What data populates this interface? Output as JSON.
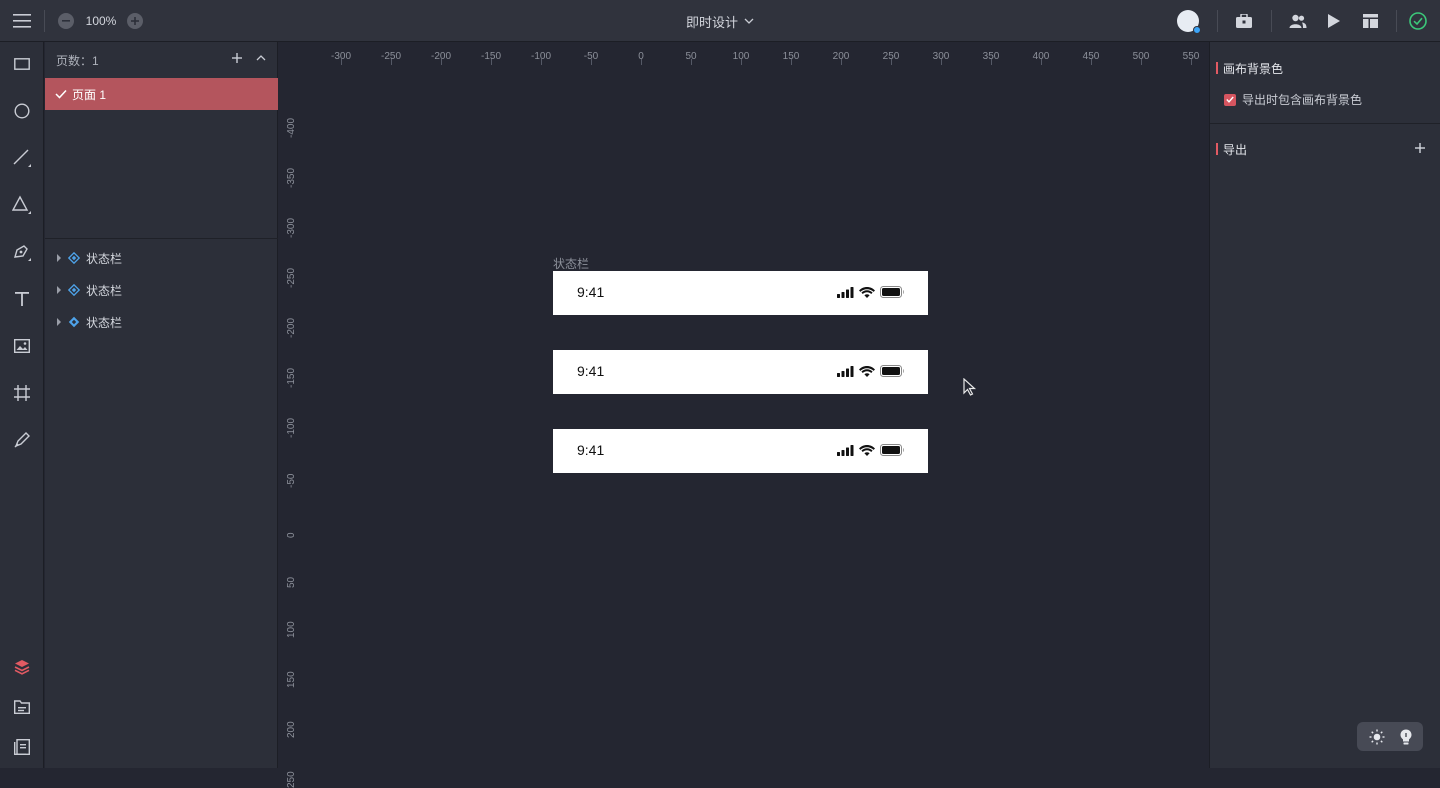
{
  "topbar": {
    "zoom_level": "100%",
    "document_title": "即时设计"
  },
  "pages": {
    "count_label": "页数：1",
    "items": [
      {
        "label": "页面 1",
        "selected": true
      }
    ]
  },
  "layers": [
    {
      "label": "状态栏"
    },
    {
      "label": "状态栏"
    },
    {
      "label": "状态栏"
    }
  ],
  "canvas": {
    "ruler_x": [
      "-300",
      "-250",
      "-200",
      "-150",
      "-100",
      "-50",
      "0",
      "50",
      "100",
      "150",
      "200",
      "250",
      "300",
      "350",
      "400",
      "450",
      "500",
      "550"
    ],
    "ruler_y": [
      "-400",
      "-350",
      "-300",
      "-250",
      "-200",
      "-150",
      "-100",
      "-50",
      "0",
      "50",
      "100",
      "150",
      "200",
      "250"
    ],
    "frame_label": "状态栏",
    "status_bars": [
      {
        "time": "9:41"
      },
      {
        "time": "9:41"
      },
      {
        "time": "9:41"
      }
    ]
  },
  "right_panel": {
    "canvas_bg_title": "画布背景色",
    "include_bg_label": "导出时包含画布背景色",
    "include_bg_checked": true,
    "export_title": "导出"
  },
  "colors": {
    "accent": "#e25a63",
    "selected_page": "#b4555d",
    "success": "#3cc87a"
  }
}
